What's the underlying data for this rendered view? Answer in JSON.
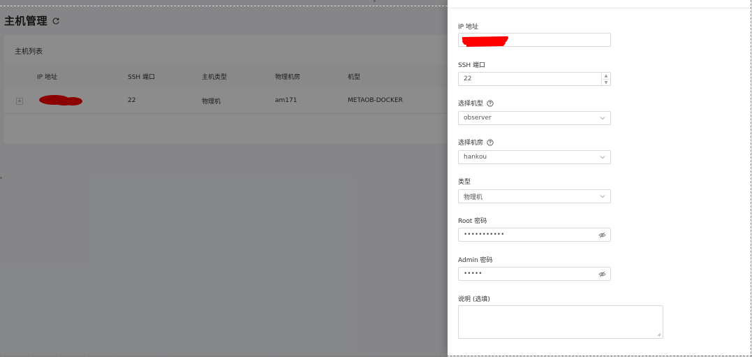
{
  "page": {
    "title": "主机管理",
    "card_title": "主机列表",
    "table": {
      "columns": [
        "IP 地址",
        "SSH 端口",
        "主机类型",
        "物理机房",
        "机型"
      ],
      "rows": [
        {
          "ip": "",
          "ssh_port": "22",
          "host_type": "物理机",
          "idc": "am171",
          "model": "METAOB-DOCKER"
        }
      ]
    }
  },
  "drawer": {
    "ip_label": "IP 地址",
    "ip_value": "",
    "ssh_label": "SSH 端口",
    "ssh_value": "22",
    "model_label": "选择机型",
    "model_value": "observer",
    "idc_label": "选择机房",
    "idc_value": "hankou",
    "type_label": "类型",
    "type_value": "物理机",
    "root_label": "Root 密码",
    "root_value": "•••••••••••",
    "admin_label": "Admin 密码",
    "admin_value": "•••••",
    "desc_label": "说明 (选填)"
  },
  "colors": {
    "redaction": "#ff0000",
    "mask": "rgba(0,0,0,0.45)"
  },
  "icons": [
    "refresh-icon",
    "expand-icon",
    "help-icon",
    "chevron-down-icon",
    "eye-off-icon"
  ]
}
